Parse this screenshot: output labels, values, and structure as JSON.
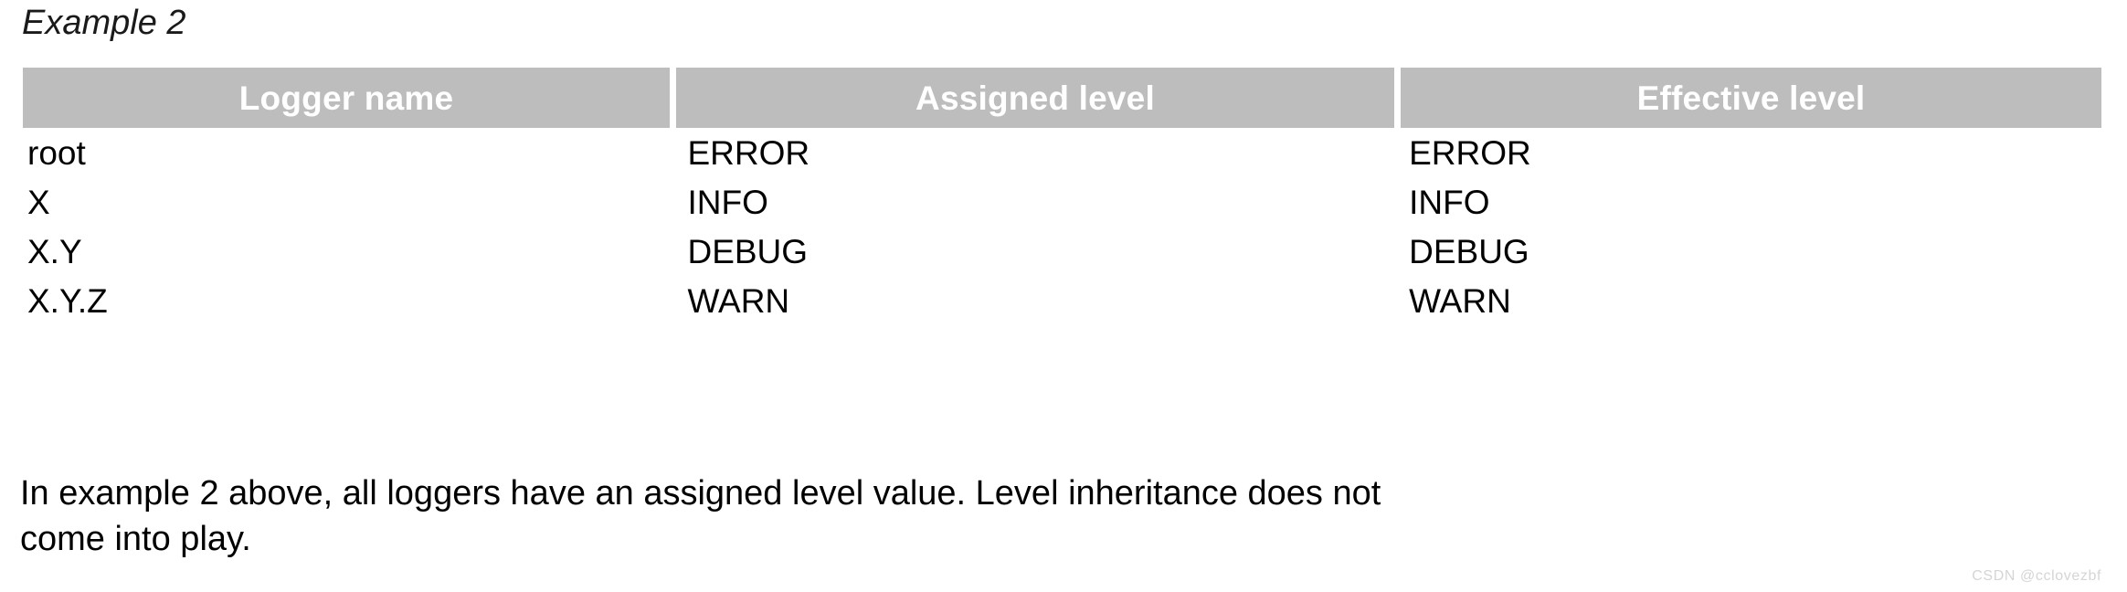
{
  "section": {
    "title": "Example 2"
  },
  "table": {
    "columns": [
      {
        "key": "logger_name",
        "label": "Logger name"
      },
      {
        "key": "assigned_level",
        "label": "Assigned level"
      },
      {
        "key": "effective_level",
        "label": "Effective level"
      }
    ],
    "header_background": "#bdbdbd",
    "header_text_color": "#ffffff",
    "rows": [
      {
        "logger_name": "root",
        "assigned_level": "ERROR",
        "effective_level": "ERROR"
      },
      {
        "logger_name": "X",
        "assigned_level": "INFO",
        "effective_level": "INFO"
      },
      {
        "logger_name": "X.Y",
        "assigned_level": "DEBUG",
        "effective_level": "DEBUG"
      },
      {
        "logger_name": "X.Y.Z",
        "assigned_level": "WARN",
        "effective_level": "WARN"
      }
    ]
  },
  "paragraph": {
    "line1": "In example 2 above, all loggers have an assigned level value. Level inheritance does not",
    "line2": "come into play."
  },
  "watermark": {
    "text": "CSDN @cclovezbf",
    "color": "#d5d5d5"
  }
}
